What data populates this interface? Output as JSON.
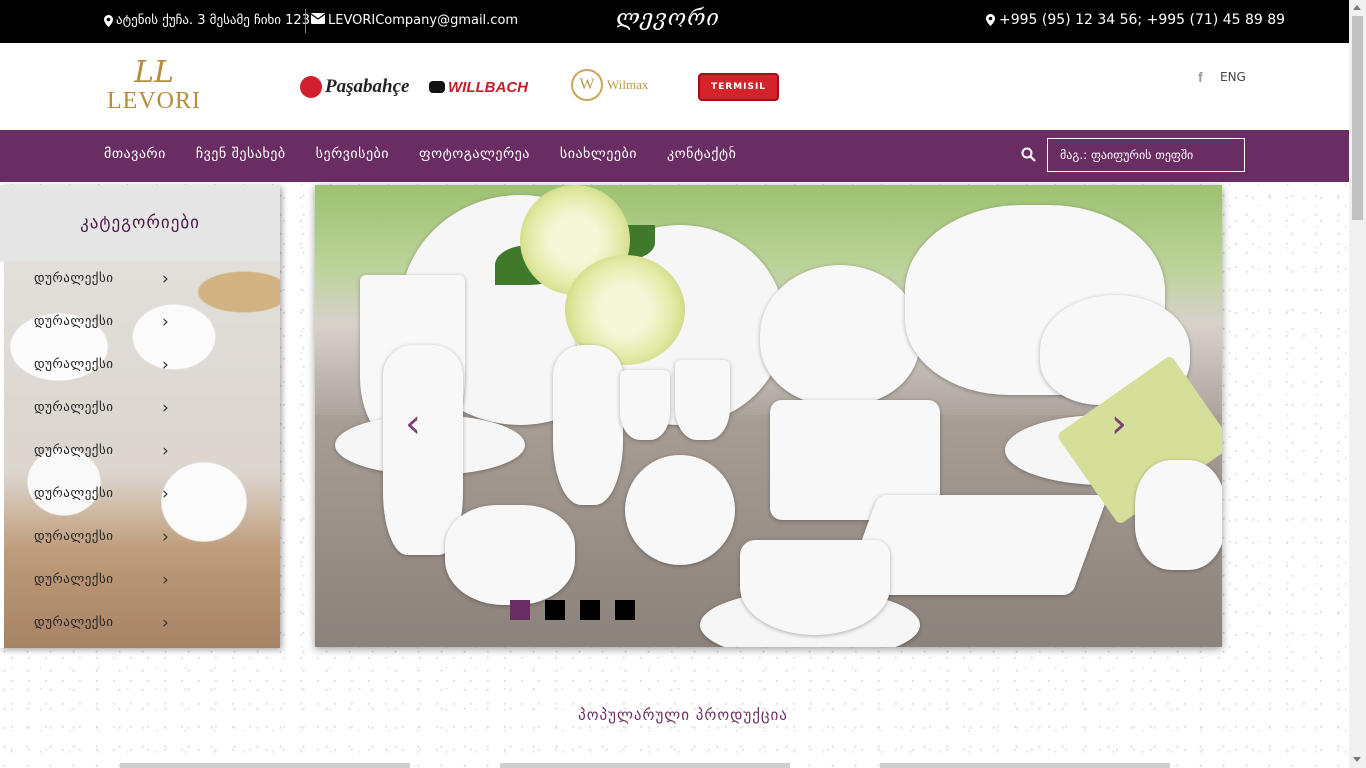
{
  "topbar": {
    "address": "ატენის ქუჩა. 3 მესამე ჩიხი 123",
    "email": "LEVORICompany@gmail.com",
    "script_logo": "ლევორი",
    "phones": "+995 (95) 12 34 56; +995 (71) 45 89 89"
  },
  "header": {
    "logo_monogram": "LL",
    "logo_text": "LEVORI",
    "brands": {
      "pasabah": "Paşabahçe",
      "willbach": "WILLBACH",
      "wilmax": "Wilmax",
      "termisil": "TERMISIL"
    },
    "social_icon": "facebook-icon",
    "language": "ENG"
  },
  "nav": {
    "items": [
      "მთავარი",
      "ჩვენ შესახებ",
      "სერვისები",
      "ფოტოგალერეა",
      "სიახლეები",
      "კონტაქტი"
    ],
    "dot": "c",
    "search_placeholder": "მაგ.: ფაიფურის თეფში"
  },
  "sidebar": {
    "title": "კატეგორიები",
    "items": [
      "დურალექსი",
      "დურალექსი",
      "დურალექსი",
      "დურალექსი",
      "დურალექსი",
      "დურალექსი",
      "დურალექსი",
      "დურალექსი",
      "დურალექსი"
    ]
  },
  "slider": {
    "prev_glyph": "‹",
    "next_glyph": "›",
    "slide_count": 4,
    "active_slide": 1
  },
  "popular": {
    "title": "პოპულარული პროდუქცია"
  },
  "colors": {
    "brand_purple": "#6a2d63",
    "gold": "#b58d3d",
    "topbar": "#000000"
  }
}
